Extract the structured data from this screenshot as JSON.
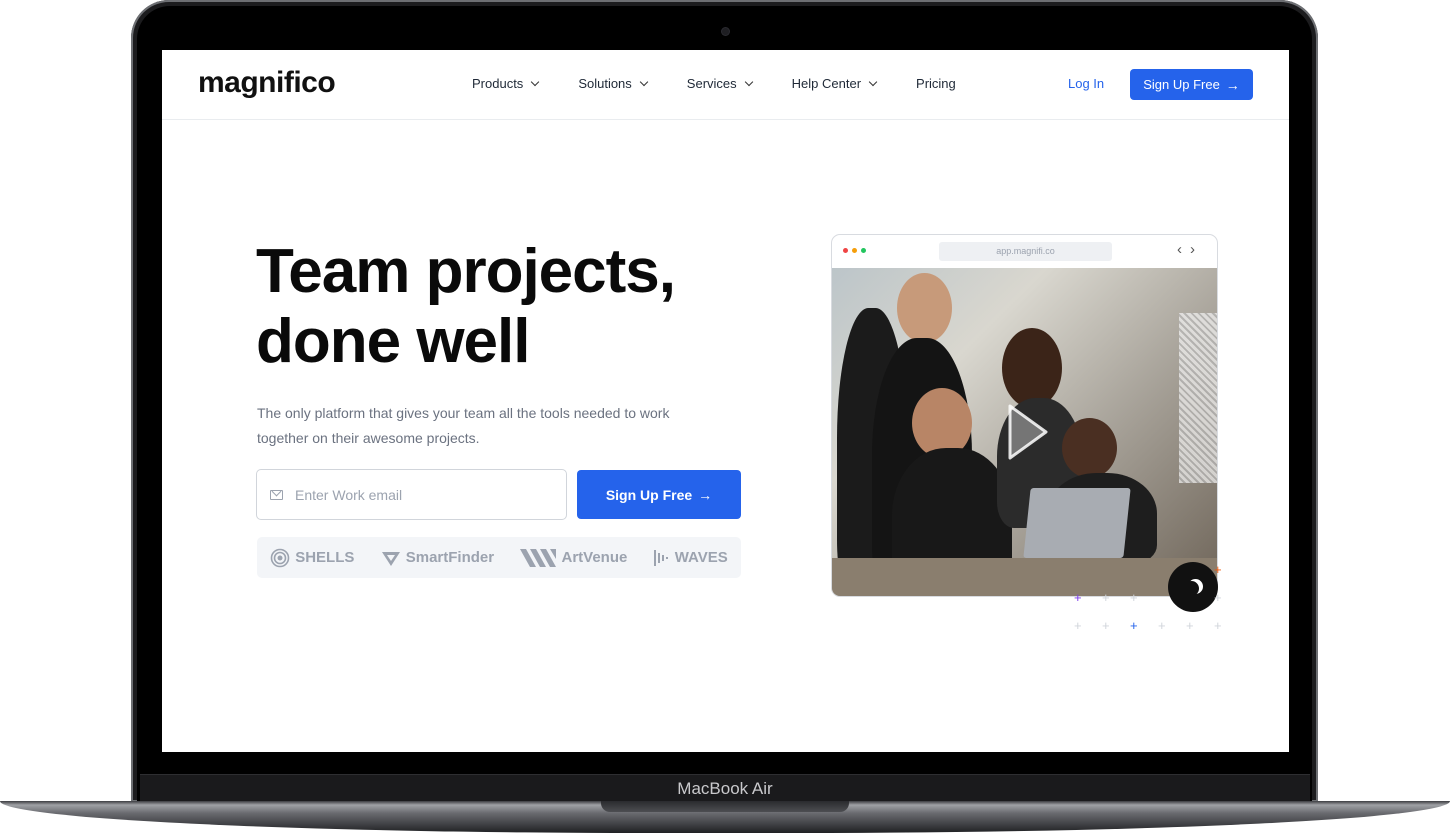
{
  "device_label": "MacBook Air",
  "site": {
    "logo": "magnifico",
    "nav": {
      "items": [
        {
          "label": "Products",
          "dropdown": true
        },
        {
          "label": "Solutions",
          "dropdown": true
        },
        {
          "label": "Services",
          "dropdown": true
        },
        {
          "label": "Help Center",
          "dropdown": true
        },
        {
          "label": "Pricing",
          "dropdown": false
        }
      ],
      "login": "Log In",
      "cta": "Sign Up Free"
    },
    "hero": {
      "title_line1": "Team projects,",
      "title_line2": "done well",
      "subtitle": "The only platform that gives your team all the tools needed to work together on their awesome projects.",
      "email_placeholder": "Enter Work email",
      "cta": "Sign Up Free"
    },
    "brands": [
      "SHELLS",
      "SmartFinder",
      "ArtVenue",
      "WAVES"
    ],
    "preview": {
      "url": "app.magnifi.co",
      "traffic_light_colors": [
        "#ef4444",
        "#f59e0b",
        "#22c55e"
      ]
    }
  },
  "colors": {
    "accent": "#2563eb",
    "dark_toggle": "#111111"
  },
  "icons": {
    "arrow": "arrow-right-icon",
    "mail": "mail-icon",
    "theme_toggle": "moon-icon",
    "video": "play-icon"
  }
}
